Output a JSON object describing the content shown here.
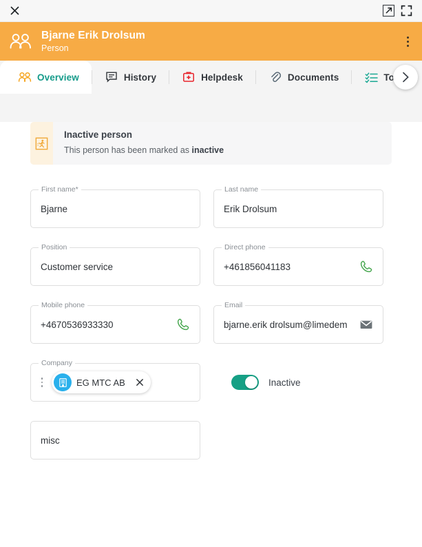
{
  "window": {
    "close_label": "close-window",
    "popout_label": "open-in-new-window",
    "fullscreen_label": "fullscreen"
  },
  "entity_header": {
    "title": "Bjarne Erik Drolsum",
    "subtitle": "Person",
    "avatar_icon": "people-icon",
    "menu_icon": "kebab-menu-icon",
    "background_color": "#f7ab45"
  },
  "tabs": {
    "items": [
      {
        "label": "Overview",
        "icon": "people-icon",
        "active": true
      },
      {
        "label": "History",
        "icon": "chat-note-icon",
        "active": false
      },
      {
        "label": "Helpdesk",
        "icon": "first-aid-kit-icon",
        "active": false
      },
      {
        "label": "Documents",
        "icon": "paperclip-icon",
        "active": false
      },
      {
        "label": "To",
        "icon": "checklist-icon",
        "active": false
      }
    ],
    "next_label": "scroll-tabs-right",
    "active_color": "#159b8a"
  },
  "banner": {
    "icon": "person-exit-icon",
    "title": "Inactive person",
    "text_before": "This person has been marked as ",
    "text_bold": "inactive",
    "icon_background": "#fdf2df",
    "background": "#f6f6f7"
  },
  "form": {
    "fields": {
      "first_name": {
        "label": "First name*",
        "value": "Bjarne"
      },
      "last_name": {
        "label": "Last name",
        "value": "Erik Drolsum"
      },
      "position": {
        "label": "Position",
        "value": "Customer service"
      },
      "direct_phone": {
        "label": "Direct phone",
        "value": "+461856041183",
        "action_icon": "phone-icon"
      },
      "mobile_phone": {
        "label": "Mobile phone",
        "value": "+4670536933330",
        "action_icon": "phone-icon"
      },
      "email": {
        "label": "Email",
        "value": "bjarne.erik drolsum@limedem",
        "action_icon": "envelope-icon"
      },
      "company": {
        "label": "Company",
        "chip_label": "EG MTC AB",
        "chip_icon": "office-building-icon",
        "chip_remove_icon": "close-icon",
        "drag_icon": "drag-handle-icon"
      },
      "misc": {
        "label": "",
        "value": "misc"
      }
    },
    "inactive_toggle": {
      "label": "Inactive",
      "state": "on",
      "color": "#16a085"
    }
  }
}
